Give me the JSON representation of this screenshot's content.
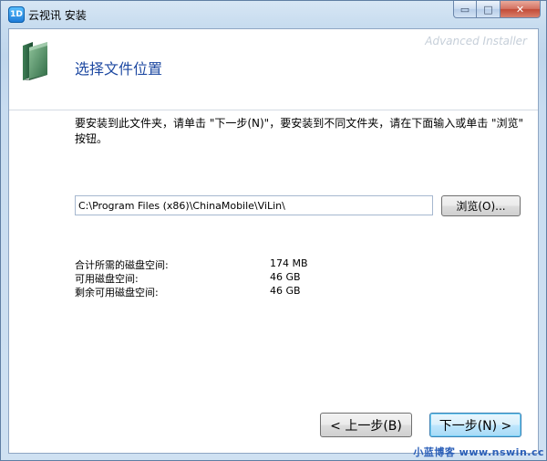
{
  "window": {
    "title": "云视讯 安装",
    "app_icon_text": "1D",
    "minimize_symbol": "▭",
    "maximize_symbol": "□",
    "close_symbol": "✕"
  },
  "header": {
    "title": "选择文件位置",
    "watermark": "Advanced Installer"
  },
  "instruction": "要安装到此文件夹，请单击 \"下一步(N)\"，要安装到不同文件夹，请在下面输入或单击 \"浏览\" 按钮。",
  "path": {
    "value": "C:\\Program Files (x86)\\ChinaMobile\\ViLin\\",
    "browse_label": "浏览(O)..."
  },
  "disk_space": [
    {
      "label": "合计所需的磁盘空间:",
      "value": "174 MB"
    },
    {
      "label": "可用磁盘空间:",
      "value": "46 GB"
    },
    {
      "label": "剩余可用磁盘空间:",
      "value": "46 GB"
    }
  ],
  "buttons": {
    "back": "< 上一步(B)",
    "next": "下一步(N) >"
  },
  "footer_watermark": "小蓝博客 www.nswin.cc",
  "colors": {
    "title_blue": "#1f4aa2",
    "frame": "#c7dcef"
  }
}
